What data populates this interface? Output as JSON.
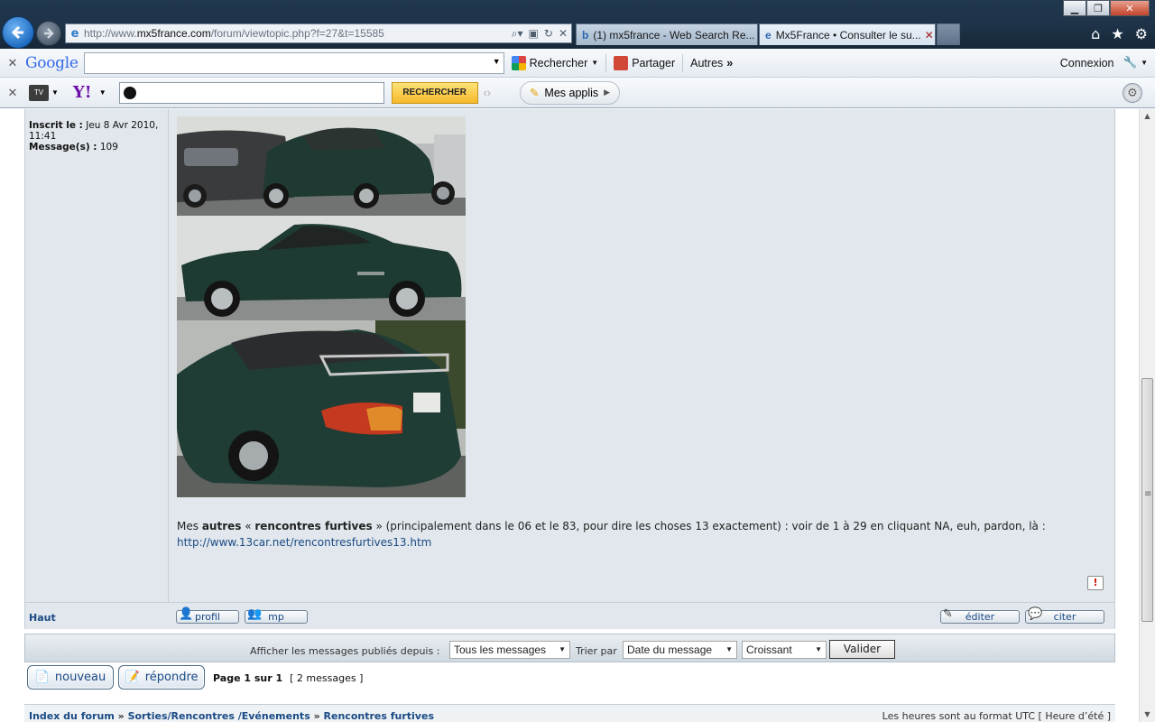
{
  "browser": {
    "url_prefix": "http://www.",
    "url_domain": "mx5france.com",
    "url_suffix": "/forum/viewtopic.php?f=27&t=15585",
    "tabs": [
      {
        "label": "(1) mx5france - Web Search Re...",
        "icon": "b"
      },
      {
        "label": "Mx5France • Consulter le su...",
        "icon": "e"
      }
    ]
  },
  "google_bar": {
    "logo": "Google",
    "search_label": "Rechercher",
    "share_label": "Partager",
    "more_label": "Autres",
    "connect_label": "Connexion"
  },
  "yahoo_bar": {
    "tv_label": "TV",
    "logo": "Y!",
    "search_button": "RECHERCHER",
    "apps_label": "Mes applis"
  },
  "post": {
    "author_joined_label": "Inscrit le :",
    "author_joined_value": "Jeu 8 Avr 2010, 11:41",
    "author_msgs_label": "Message(s) :",
    "author_msgs_value": "109",
    "text_prefix": "Mes ",
    "text_bold1": "autres",
    "text_mid1": " « ",
    "text_bold2": "rencontres furtives",
    "text_rest": " » (principalement dans le 06 et le 83, pour dire les choses 13 exactement) : voir de 1 à 29 en cliquant NA, euh, pardon, là :",
    "link": "http://www.13car.net/rencontresfurtives13.htm",
    "report_icon": "!"
  },
  "post_footer": {
    "top_link": "Haut",
    "profil": "profil",
    "mp": "mp",
    "editer": "éditer",
    "citer": "citer"
  },
  "sort_bar": {
    "show_label": "Afficher les messages publiés depuis :",
    "show_value": "Tous les messages",
    "sort_label": "Trier par",
    "sort_value": "Date du message",
    "order_value": "Croissant",
    "submit": "Valider"
  },
  "actions": {
    "new_topic": "nouveau",
    "reply": "répondre",
    "page_info": "Page 1 sur 1",
    "message_count": "[ 2 messages ]"
  },
  "breadcrumb": {
    "items": [
      "Index du forum",
      "Sorties/Rencontres /Evénements",
      "Rencontres furtives"
    ],
    "separator": "»",
    "timezone_note": "Les heures sont au format UTC [ Heure d’été ]"
  }
}
